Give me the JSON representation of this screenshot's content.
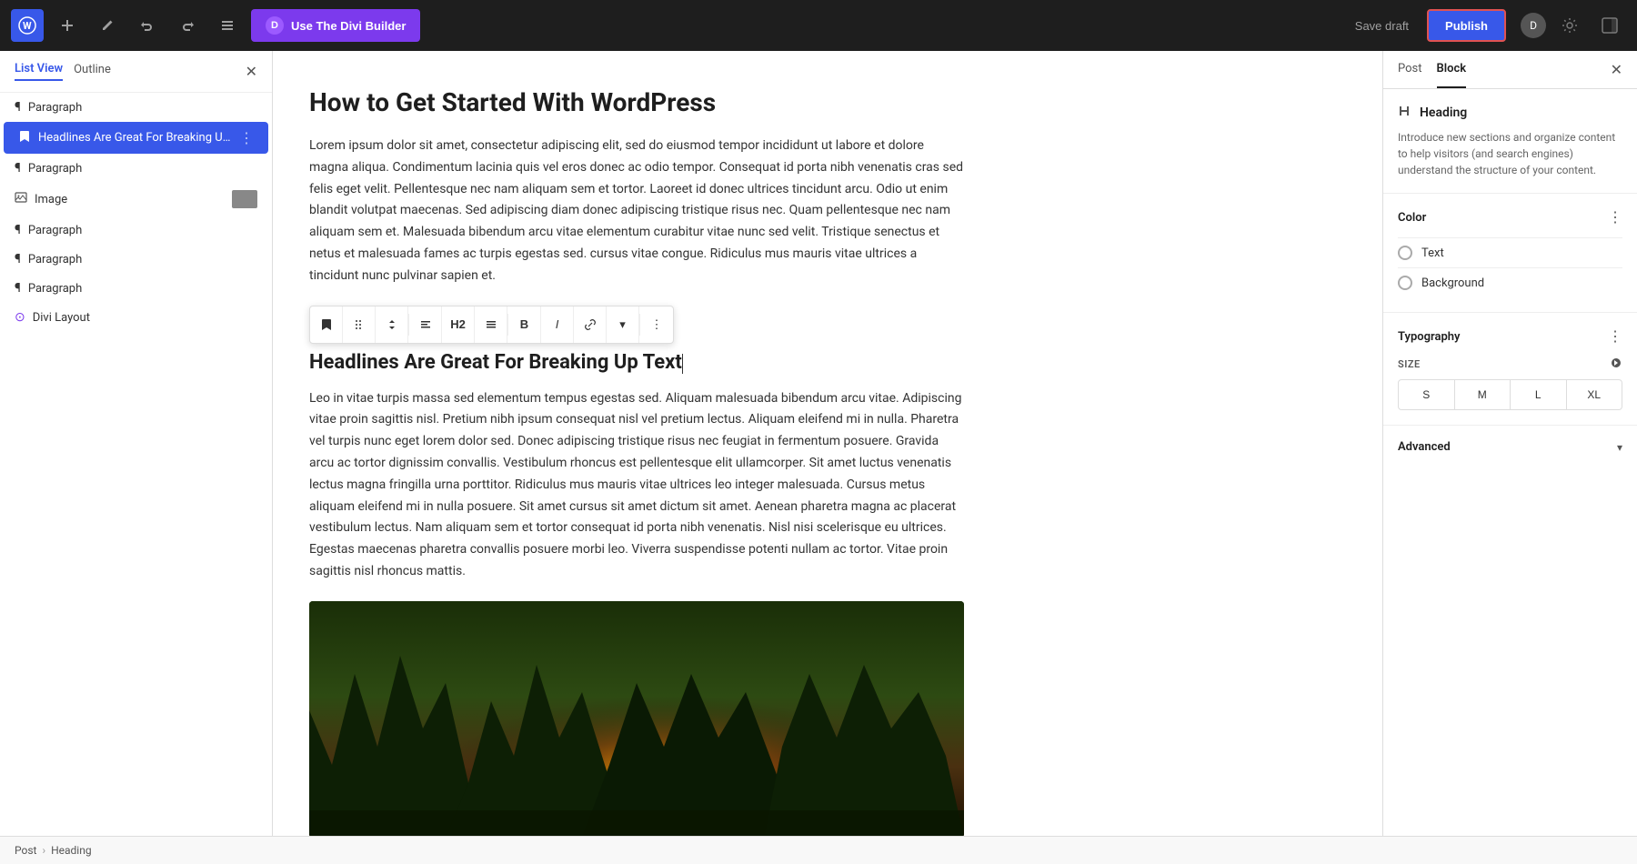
{
  "topbar": {
    "wp_logo": "W",
    "add_label": "+",
    "edit_label": "✎",
    "undo_label": "↩",
    "redo_label": "↪",
    "list_label": "≡",
    "divi_btn": "Use The Divi Builder",
    "divi_icon": "D",
    "save_draft": "Save draft",
    "publish": "Publish",
    "settings_icon": "⊙",
    "panel_icon": "▣"
  },
  "sidebar": {
    "tab1": "List View",
    "tab2": "Outline",
    "items": [
      {
        "icon": "¶",
        "label": "Paragraph",
        "active": false
      },
      {
        "icon": "🔖",
        "label": "Headlines Are Great For Breaking Up T...",
        "active": true,
        "has_more": true
      },
      {
        "icon": "¶",
        "label": "Paragraph",
        "active": false
      },
      {
        "icon": "🖼",
        "label": "Image",
        "active": false,
        "has_thumb": true
      },
      {
        "icon": "¶",
        "label": "Paragraph",
        "active": false
      },
      {
        "icon": "¶",
        "label": "Paragraph",
        "active": false
      },
      {
        "icon": "¶",
        "label": "Paragraph",
        "active": false
      },
      {
        "icon": "⊙",
        "label": "Divi Layout",
        "active": false
      }
    ]
  },
  "content": {
    "post_title": "How to Get Started With WordPress",
    "body1": "Lorem ipsum dolor sit amet, consectetur adipiscing elit, sed do eiusmod tempor incididunt ut labore et dolore magna aliqua. Condimentum lacinia quis vel eros donec ac odio tempor. Consequat id porta nibh venenatis cras sed felis eget velit. Pellentesque nec nam aliquam sem et tortor. Laoreet id donec ultrices tincidunt arcu. Odio ut enim blandit volutpat maecenas. Sed adipiscing diam donec adipiscing tristique risus nec. Quam pellentesque nec nam aliquam sem et. Malesuada bibendum arcu vitae elementum curabitur vitae nunc sed velit. Tristique senectus et netus et malesuada fames ac turpis egestas sed. cursus vitae congue. Ridiculus mus mauris vitae ultrices a tincidunt nunc pulvinar sapien et.",
    "heading": "Headlines Are Great For Breaking Up Text",
    "body2": "Leo in vitae turpis massa sed elementum tempus egestas sed. Aliquam malesuada bibendum arcu vitae. Adipiscing vitae proin sagittis nisl. Pretium nibh ipsum consequat nisl vel pretium lectus. Aliquam eleifend mi in nulla. Pharetra vel turpis nunc eget lorem dolor sed. Donec adipiscing tristique risus nec feugiat in fermentum posuere. Gravida arcu ac tortor dignissim convallis. Vestibulum rhoncus est pellentesque elit ullamcorper. Sit amet luctus venenatis lectus magna fringilla urna porttitor. Ridiculus mus mauris vitae ultrices leo integer malesuada. Cursus metus aliquam eleifend mi in nulla posuere. Sit amet cursus sit amet dictum sit amet. Aenean pharetra magna ac placerat vestibulum lectus. Nam aliquam sem et tortor consequat id porta nibh venenatis. Nisl nisi scelerisque eu ultrices. Egestas maecenas pharetra convallis posuere morbi leo. Viverra suspendisse potenti nullam ac tortor. Vitae proin sagittis nisl rhoncus mattis."
  },
  "toolbar": {
    "bookmark": "🔖",
    "drag": "⠿",
    "arrows": "⇅",
    "align_left": "≡",
    "h2": "H2",
    "align_full": "≡",
    "bold": "B",
    "italic": "I",
    "link": "🔗",
    "chevron": "▾",
    "more": "⋮"
  },
  "right_panel": {
    "tab_post": "Post",
    "tab_block": "Block",
    "block_icon": "🔖",
    "block_title": "Heading",
    "block_desc": "Introduce new sections and organize content to help visitors (and search engines) understand the structure of your content.",
    "color_section_title": "Color",
    "text_label": "Text",
    "background_label": "Background",
    "typography_title": "Typography",
    "size_label": "SIZE",
    "size_options": [
      "S",
      "M",
      "L",
      "XL"
    ],
    "advanced_title": "Advanced"
  },
  "breadcrumb": {
    "post": "Post",
    "sep": "›",
    "heading": "Heading"
  },
  "colors": {
    "accent": "#3858e9",
    "divi": "#7c3aed",
    "publish_border": "#e05252",
    "active_sidebar": "#3858e9"
  }
}
